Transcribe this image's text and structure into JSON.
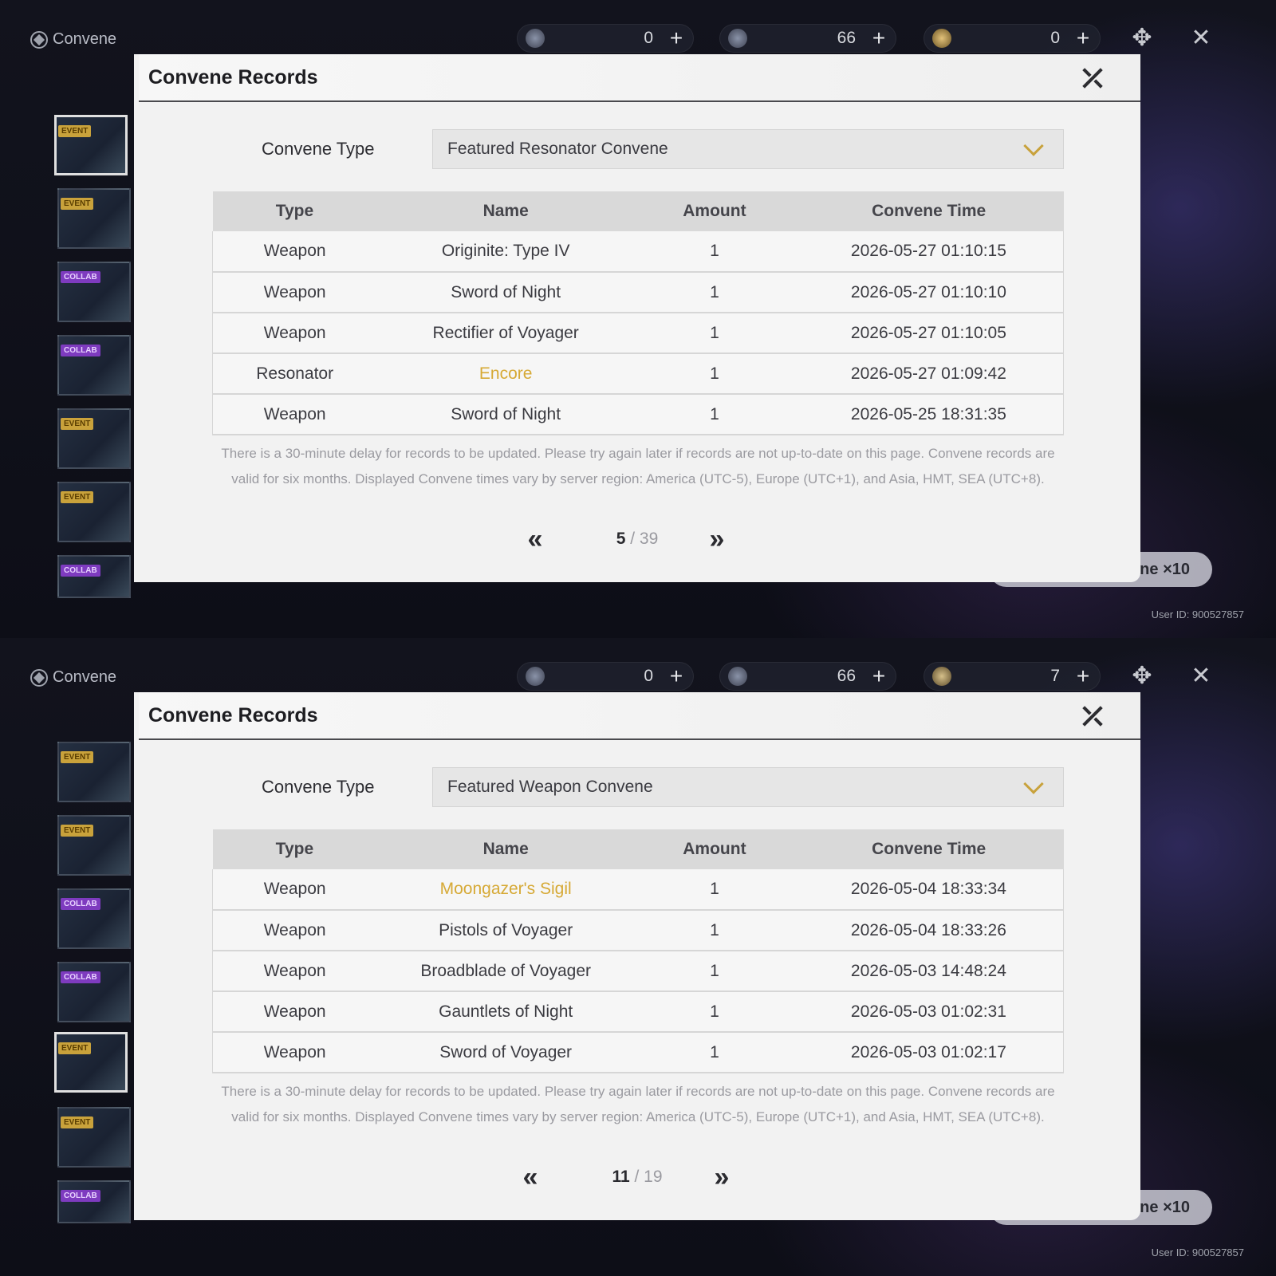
{
  "screens": [
    {
      "app_title": "Convene",
      "currencies": [
        {
          "icon": "lunite-icon",
          "value": "0",
          "plus": "+"
        },
        {
          "icon": "astrite-icon",
          "value": "66",
          "plus": "+"
        },
        {
          "icon": "radiant-tide-icon",
          "value": "0",
          "plus": "+"
        }
      ],
      "sidebar_tags": [
        "EVENT",
        "EVENT",
        "COLLAB",
        "COLLAB",
        "EVENT",
        "EVENT",
        "COLLAB"
      ],
      "convene_x10": "ne ×10",
      "user_id": "User ID: 900527857",
      "modal": {
        "title": "Convene Records",
        "type_label": "Convene Type",
        "type_value": "Featured Resonator Convene",
        "headers": [
          "Type",
          "Name",
          "Amount",
          "Convene Time"
        ],
        "rows": [
          {
            "type": "Weapon",
            "name": "Originite: Type IV",
            "amount": "1",
            "time": "2026-05-27 01:10:15"
          },
          {
            "type": "Weapon",
            "name": "Sword of Night",
            "amount": "1",
            "time": "2026-05-27 01:10:10"
          },
          {
            "type": "Weapon",
            "name": "Rectifier of Voyager",
            "amount": "1",
            "time": "2026-05-27 01:10:05"
          },
          {
            "type": "Resonator",
            "name": "Encore",
            "amount": "1",
            "time": "2026-05-27 01:09:42"
          },
          {
            "type": "Weapon",
            "name": "Sword of Night",
            "amount": "1",
            "time": "2026-05-25 18:31:35"
          }
        ],
        "notice": "There is a 30-minute delay for records to be updated. Please try again later if records are not up-to-date on this page. Convene records are valid for six months. Displayed Convene times vary by server region: America (UTC-5), Europe (UTC+1), and Asia, HMT, SEA (UTC+8).",
        "page_current": "5",
        "page_total": " / 39",
        "prev": "«",
        "next": "»"
      }
    },
    {
      "app_title": "Convene",
      "currencies": [
        {
          "icon": "lunite-icon",
          "value": "0",
          "plus": "+"
        },
        {
          "icon": "astrite-icon",
          "value": "66",
          "plus": "+"
        },
        {
          "icon": "forging-tide-icon",
          "value": "7",
          "plus": "+"
        }
      ],
      "sidebar_tags": [
        "EVENT",
        "EVENT",
        "COLLAB",
        "COLLAB",
        "EVENT",
        "EVENT",
        "COLLAB"
      ],
      "convene_x10": "ne ×10",
      "user_id": "User ID: 900527857",
      "modal": {
        "title": "Convene Records",
        "type_label": "Convene Type",
        "type_value": "Featured Weapon Convene",
        "headers": [
          "Type",
          "Name",
          "Amount",
          "Convene Time"
        ],
        "rows": [
          {
            "type": "Weapon",
            "name": "Moongazer's Sigil",
            "amount": "1",
            "time": "2026-05-04 18:33:34"
          },
          {
            "type": "Weapon",
            "name": "Pistols of Voyager",
            "amount": "1",
            "time": "2026-05-04 18:33:26"
          },
          {
            "type": "Weapon",
            "name": "Broadblade of Voyager",
            "amount": "1",
            "time": "2026-05-03 14:48:24"
          },
          {
            "type": "Weapon",
            "name": "Gauntlets of Night",
            "amount": "1",
            "time": "2026-05-03 01:02:31"
          },
          {
            "type": "Weapon",
            "name": "Sword of Voyager",
            "amount": "1",
            "time": "2026-05-03 01:02:17"
          }
        ],
        "notice": "There is a 30-minute delay for records to be updated. Please try again later if records are not up-to-date on this page. Convene records are valid for six months. Displayed Convene times vary by server region: America (UTC-5), Europe (UTC+1), and Asia, HMT, SEA (UTC+8).",
        "page_current": "11",
        "page_total": " / 19",
        "prev": "«",
        "next": "»"
      }
    }
  ],
  "colors": {
    "highlight_5star": "#d6a935",
    "accent_chevron": "#c8a23c"
  }
}
